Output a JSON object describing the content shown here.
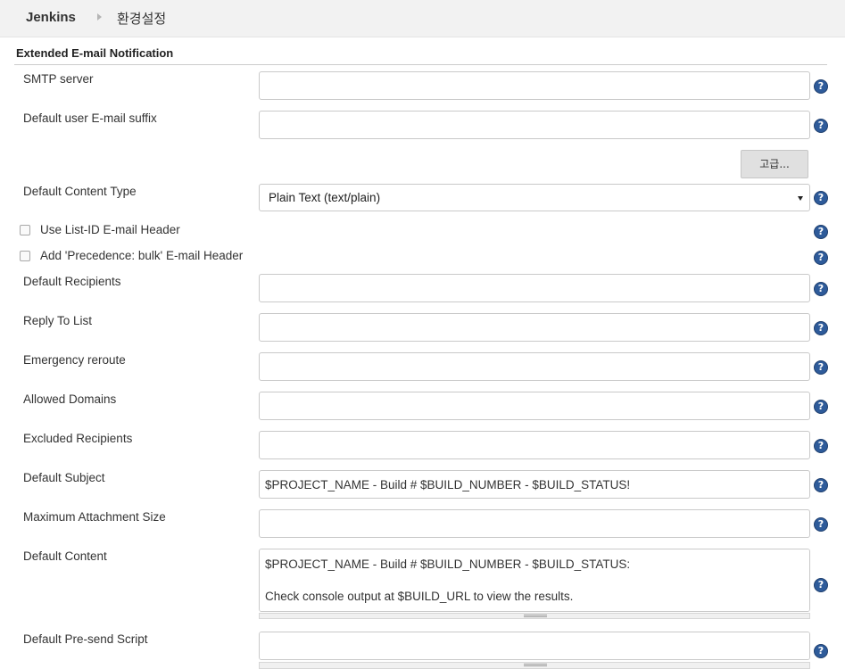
{
  "breadcrumb": {
    "home": "Jenkins",
    "page": "환경설정"
  },
  "section": {
    "title": "Extended E-mail Notification"
  },
  "fields": {
    "smtp_server": {
      "label": "SMTP server",
      "value": ""
    },
    "default_suffix": {
      "label": "Default user E-mail suffix",
      "value": ""
    },
    "content_type": {
      "label": "Default Content Type",
      "value": "Plain Text (text/plain)"
    },
    "list_id": {
      "label": "Use List-ID E-mail Header"
    },
    "precedence": {
      "label": "Add 'Precedence: bulk' E-mail Header"
    },
    "recipients": {
      "label": "Default Recipients",
      "value": ""
    },
    "reply_to": {
      "label": "Reply To List",
      "value": ""
    },
    "emergency": {
      "label": "Emergency reroute",
      "value": ""
    },
    "allowed_domains": {
      "label": "Allowed Domains",
      "value": ""
    },
    "excluded": {
      "label": "Excluded Recipients",
      "value": ""
    },
    "subject": {
      "label": "Default Subject",
      "value": "$PROJECT_NAME - Build # $BUILD_NUMBER - $BUILD_STATUS!"
    },
    "max_attachment": {
      "label": "Maximum Attachment Size",
      "value": ""
    },
    "content": {
      "label": "Default Content",
      "value": "$PROJECT_NAME - Build # $BUILD_NUMBER - $BUILD_STATUS:\n\nCheck console output at $BUILD_URL to view the results."
    },
    "presend": {
      "label": "Default Pre-send Script",
      "value": ""
    }
  },
  "advanced_button": "고급...",
  "help_glyph": "?"
}
